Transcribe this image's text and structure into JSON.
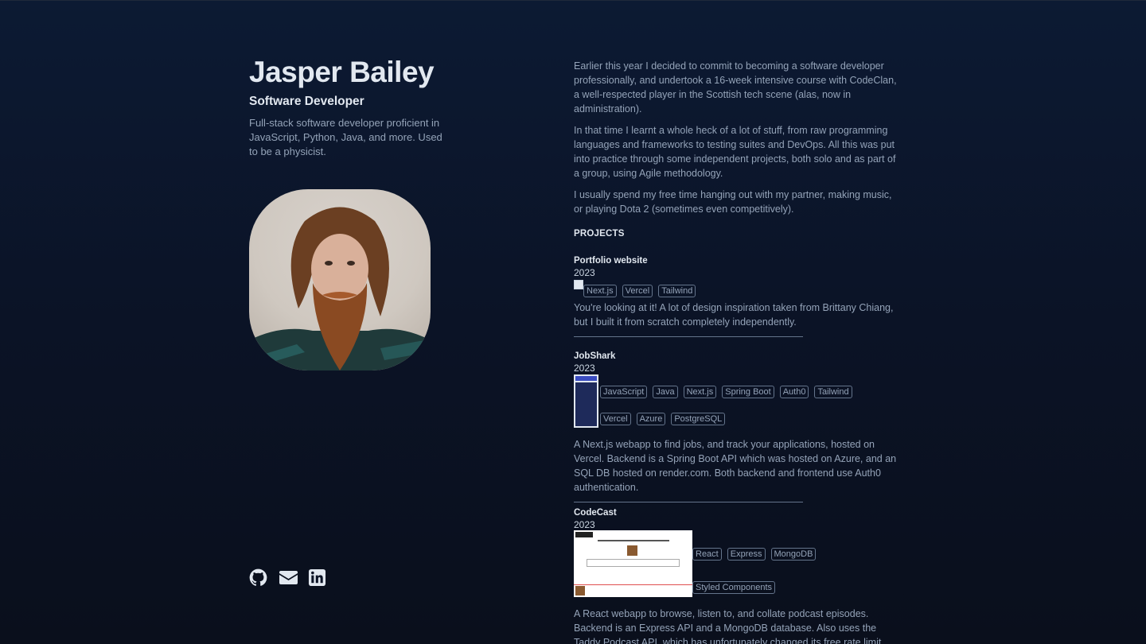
{
  "profile": {
    "name": "Jasper Bailey",
    "role": "Software Developer",
    "tagline": "Full-stack software developer proficient in JavaScript, Python, Java, and more. Used to be a physicist."
  },
  "social": [
    {
      "icon": "github-icon"
    },
    {
      "icon": "mail-icon"
    },
    {
      "icon": "linkedin-icon"
    }
  ],
  "bio": [
    "Earlier this year I decided to commit to becoming a software developer professionally, and undertook a 16-week intensive course with CodeClan, a well-respected player in the Scottish tech scene (alas, now in administration).",
    "In that time I learnt a whole heck of a lot of stuff, from raw programming languages and frameworks to testing suites and DevOps. All this was put into practice through some independent projects, both solo and as part of a group, using Agile methodology.",
    "I usually spend my free time hanging out with my partner, making music, or playing Dota 2 (sometimes even competitively)."
  ],
  "projects_heading": "PROJECTS",
  "projects": [
    {
      "title": "Portfolio website",
      "year": "2023",
      "tags": [
        "Next.js",
        "Vercel",
        "Tailwind"
      ],
      "description": "You're looking at it! A lot of design inspiration taken from Brittany Chiang, but I built it from scratch completely independently."
    },
    {
      "title": "JobShark",
      "year": "2023",
      "tags": [
        "JavaScript",
        "Java",
        "Next.js",
        "Spring Boot",
        "Auth0",
        "Tailwind",
        "Vercel",
        "Azure",
        "PostgreSQL"
      ],
      "description": "A Next.js webapp to find jobs, and track your applications, hosted on Vercel. Backend is a Spring Boot API which was hosted on Azure, and an SQL DB hosted on render.com. Both backend and frontend use Auth0 authentication."
    },
    {
      "title": "CodeCast",
      "year": "2023",
      "tags": [
        "React",
        "Express",
        "MongoDB",
        "Styled Components"
      ],
      "description": "A React webapp to browse, listen to, and collate podcast episodes. Backend is an Express API and a MongoDB database. Also uses the Taddy Podcast API, which has unfortunately changed its free rate limit"
    }
  ]
}
